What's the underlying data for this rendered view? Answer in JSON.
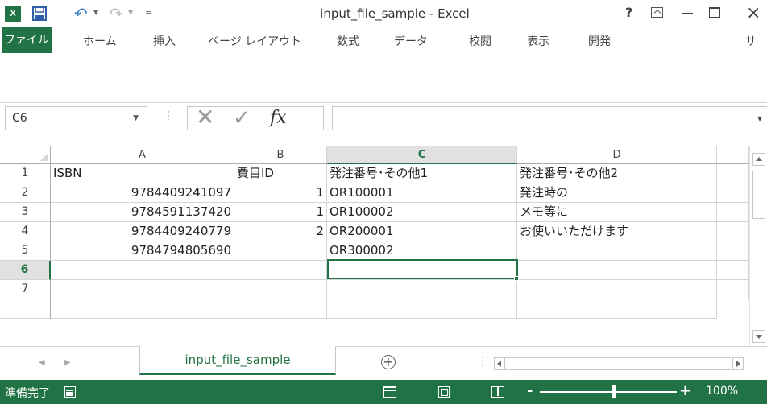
{
  "titlebar": {
    "app_icon": "X",
    "title": "input_file_sample - Excel",
    "help": "?",
    "quick_access": [
      "save-icon",
      "undo-icon",
      "redo-icon",
      "customize-icon"
    ]
  },
  "ribbon": {
    "file_tab": "ファイル",
    "tabs": [
      "ホーム",
      "挿入",
      "ページ レイアウト",
      "数式",
      "データ",
      "校閲",
      "表示",
      "開発",
      "サ"
    ]
  },
  "formula_bar": {
    "name_box": "C6",
    "fx": "fx",
    "value": ""
  },
  "sheet": {
    "columns": [
      "A",
      "B",
      "C",
      "D"
    ],
    "active_column": "C",
    "active_row": "6",
    "rows": [
      {
        "num": "1",
        "cells": [
          "ISBN",
          "費目ID",
          "発注番号･その他1",
          "発注番号･その他2"
        ]
      },
      {
        "num": "2",
        "cells": [
          "9784409241097",
          "1",
          "OR100001",
          "発注時の"
        ]
      },
      {
        "num": "3",
        "cells": [
          "9784591137420",
          "1",
          "OR100002",
          "メモ等に"
        ]
      },
      {
        "num": "4",
        "cells": [
          "9784409240779",
          "2",
          "OR200001",
          "お使いいただけます"
        ]
      },
      {
        "num": "5",
        "cells": [
          "9784794805690",
          "",
          "OR300002",
          ""
        ]
      },
      {
        "num": "6",
        "cells": [
          "",
          "",
          "",
          ""
        ]
      },
      {
        "num": "7",
        "cells": [
          "",
          "",
          "",
          ""
        ]
      }
    ]
  },
  "sheet_tabs": {
    "active": "input_file_sample"
  },
  "statusbar": {
    "status": "準備完了",
    "zoom": "100%",
    "zoom_level_fraction": 0.53
  },
  "colors": {
    "excel_green": "#217346",
    "gridline": "#d4d4d4"
  }
}
